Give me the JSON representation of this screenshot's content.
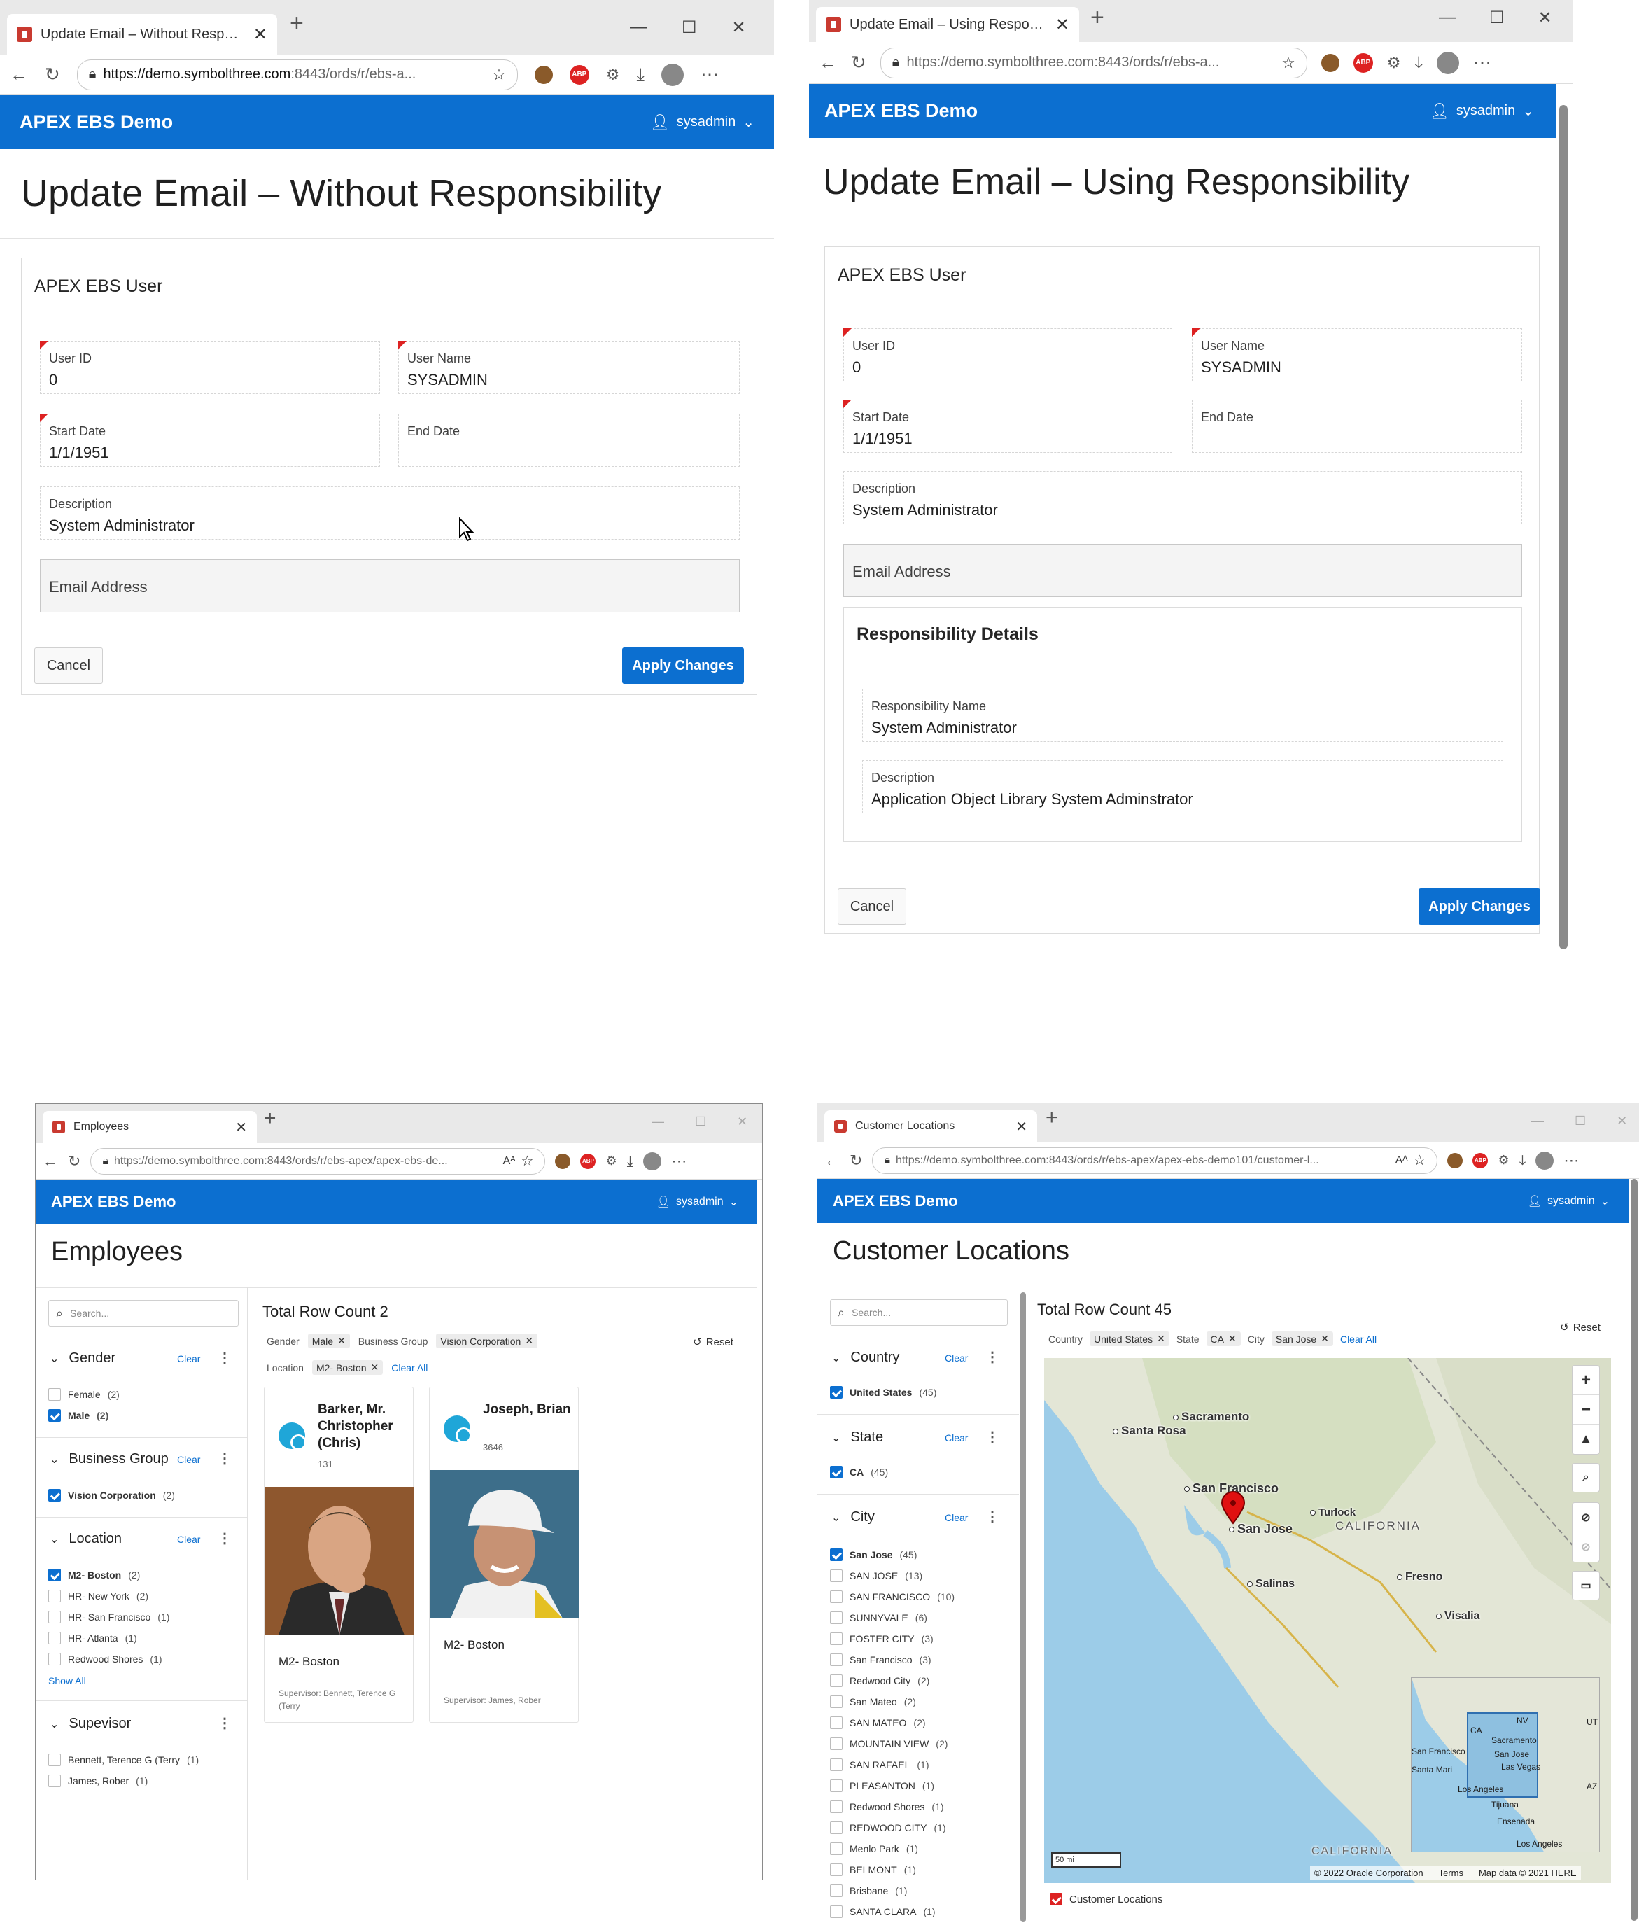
{
  "app": {
    "brand": "APEX EBS Demo",
    "user": "sysadmin"
  },
  "colors": {
    "header": "#0c6fd0",
    "required": "#dd2222",
    "map_water": "#9ccce8",
    "map_land": "#e3e6d6"
  },
  "icons": [
    "back-icon",
    "reload-icon",
    "lock-icon",
    "star-icon",
    "cookie-icon",
    "abp-icon",
    "puzzle-icon",
    "download-icon",
    "profile-icon",
    "more-icon",
    "user-icon",
    "chevron-down-icon",
    "search-icon",
    "reset-icon",
    "close-icon",
    "map-pin-icon",
    "zoom-in-icon",
    "zoom-out-icon",
    "compass-icon"
  ],
  "w1": {
    "tab_title": "Update Email – Without Responsibility",
    "url_host": "https://demo.symbolthree.com",
    "url_rest": ":8443/ords/r/ebs-a...",
    "page_title": "Update Email – Without Responsibility",
    "region_title": "APEX EBS User",
    "fields": {
      "user_id": {
        "label": "User ID",
        "value": "0"
      },
      "user_name": {
        "label": "User Name",
        "value": "SYSADMIN"
      },
      "start_date": {
        "label": "Start Date",
        "value": "1/1/1951"
      },
      "end_date": {
        "label": "End Date",
        "value": ""
      },
      "description": {
        "label": "Description",
        "value": "System Administrator"
      },
      "email": {
        "label": "Email Address"
      }
    },
    "cancel": "Cancel",
    "apply": "Apply Changes"
  },
  "w2": {
    "tab_title": "Update Email – Using Responsibility",
    "url_host": "https://demo.symbolthree.com",
    "url_rest": ":8443/ords/r/ebs-a...",
    "page_title": "Update Email – Using Responsibility",
    "region_title": "APEX EBS User",
    "fields": {
      "user_id": {
        "label": "User ID",
        "value": "0"
      },
      "user_name": {
        "label": "User Name",
        "value": "SYSADMIN"
      },
      "start_date": {
        "label": "Start Date",
        "value": "1/1/1951"
      },
      "end_date": {
        "label": "End Date",
        "value": ""
      },
      "description": {
        "label": "Description",
        "value": "System Administrator"
      },
      "email": {
        "label": "Email Address"
      }
    },
    "resp_region_title": "Responsibility Details",
    "resp_name": {
      "label": "Responsibility Name",
      "value": "System Administrator"
    },
    "resp_desc": {
      "label": "Description",
      "value": "Application Object Library System Adminstrator"
    },
    "cancel": "Cancel",
    "apply": "Apply Changes"
  },
  "w3": {
    "tab_title": "Employees",
    "url_host": "https://demo.symbolthree.com",
    "url_rest": ":8443/ords/r/ebs-apex/apex-ebs-de...",
    "page_title": "Employees",
    "search_placeholder": "Search...",
    "total": "Total Row Count 2",
    "chips": {
      "gender_k": "Gender",
      "gender_v": "Male",
      "bg_k": "Business Group",
      "bg_v": "Vision Corporation",
      "loc_k": "Location",
      "loc_v": "M2- Boston",
      "clear_all": "Clear All"
    },
    "reset": "Reset",
    "facets": {
      "gender": {
        "title": "Gender",
        "clear": "Clear",
        "items": [
          {
            "label": "Female",
            "count": "(2)"
          },
          {
            "label": "Male",
            "count": "(2)"
          }
        ]
      },
      "business_group": {
        "title": "Business Group",
        "clear": "Clear",
        "items": [
          {
            "label": "Vision Corporation",
            "count": "(2)"
          }
        ]
      },
      "location": {
        "title": "Location",
        "clear": "Clear",
        "items": [
          {
            "label": "M2- Boston",
            "count": "(2)"
          },
          {
            "label": "HR- New York",
            "count": "(2)"
          },
          {
            "label": "HR- San Francisco",
            "count": "(1)"
          },
          {
            "label": "HR- Atlanta",
            "count": "(1)"
          },
          {
            "label": "Redwood Shores",
            "count": "(1)"
          }
        ],
        "show_all": "Show All"
      },
      "supervisor": {
        "title": "Supevisor",
        "items": [
          {
            "label": "Bennett, Terence G (Terry",
            "count": "(1)"
          },
          {
            "label": "James, Rober",
            "count": "(1)"
          }
        ]
      }
    },
    "cards": [
      {
        "name": "Barker, Mr. Christopher (Chris)",
        "number": "131",
        "location": "M2- Boston",
        "supervisor": "Supervisor: Bennett, Terence G (Terry"
      },
      {
        "name": "Joseph, Brian",
        "number": "3646",
        "location": "M2- Boston",
        "supervisor": "Supervisor: James, Rober"
      }
    ]
  },
  "w4": {
    "tab_title": "Customer Locations",
    "url_host": "https://demo.symbolthree.com",
    "url_rest": ":8443/ords/r/ebs-apex/apex-ebs-demo101/customer-l...",
    "page_title": "Customer Locations",
    "search_placeholder": "Search...",
    "total": "Total Row Count 45",
    "reset": "Reset",
    "chips": {
      "country_k": "Country",
      "country_v": "United States",
      "state_k": "State",
      "state_v": "CA",
      "city_k": "City",
      "city_v": "San Jose",
      "clear_all": "Clear All"
    },
    "facets": {
      "country": {
        "title": "Country",
        "clear": "Clear",
        "items": [
          {
            "label": "United States",
            "count": "(45)"
          }
        ]
      },
      "state": {
        "title": "State",
        "clear": "Clear",
        "items": [
          {
            "label": "CA",
            "count": "(45)"
          }
        ]
      },
      "city": {
        "title": "City",
        "clear": "Clear",
        "items": [
          {
            "label": "San Jose",
            "count": "(45)"
          },
          {
            "label": "SAN JOSE",
            "count": "(13)"
          },
          {
            "label": "SAN FRANCISCO",
            "count": "(10)"
          },
          {
            "label": "SUNNYVALE",
            "count": "(6)"
          },
          {
            "label": "FOSTER CITY",
            "count": "(3)"
          },
          {
            "label": "San Francisco",
            "count": "(3)"
          },
          {
            "label": "Redwood City",
            "count": "(2)"
          },
          {
            "label": "San Mateo",
            "count": "(2)"
          },
          {
            "label": "SAN MATEO",
            "count": "(2)"
          },
          {
            "label": "MOUNTAIN VIEW",
            "count": "(2)"
          },
          {
            "label": "SAN RAFAEL",
            "count": "(1)"
          },
          {
            "label": "PLEASANTON",
            "count": "(1)"
          },
          {
            "label": "Redwood Shores",
            "count": "(1)"
          },
          {
            "label": "REDWOOD CITY",
            "count": "(1)"
          },
          {
            "label": "Menlo Park",
            "count": "(1)"
          },
          {
            "label": "BELMONT",
            "count": "(1)"
          },
          {
            "label": "Brisbane",
            "count": "(1)"
          },
          {
            "label": "SANTA CLARA",
            "count": "(1)"
          }
        ]
      }
    },
    "map": {
      "labels": {
        "sacramento": "Sacramento",
        "santa_rosa": "Santa Rosa",
        "san_francisco": "San Francisco",
        "san_jose": "San Jose",
        "turlock": "Turlock",
        "california": "CALIFORNIA",
        "fresno": "Fresno",
        "salinas": "Salinas",
        "visalia": "Visalia",
        "california2": "CALIFORNIA"
      },
      "overview": {
        "nv": "NV",
        "ca": "CA",
        "ut": "UT",
        "az": "AZ",
        "sacramento": "Sacramento",
        "san_jose": "San Jose",
        "las_vegas": "Las Vegas",
        "san_francisco": "San Francisco",
        "santa_maria": "Santa Mari",
        "los_angeles": "Los Angeles",
        "tijuana": "Tijuana",
        "ensenada": "Ensenada",
        "los_angeles2": "Los Angeles"
      },
      "scale": "50 mi",
      "copyright": "© 2022 Oracle Corporation",
      "terms": "Terms",
      "mapdata": "Map data © 2021 HERE",
      "legend": "Customer Locations"
    }
  }
}
